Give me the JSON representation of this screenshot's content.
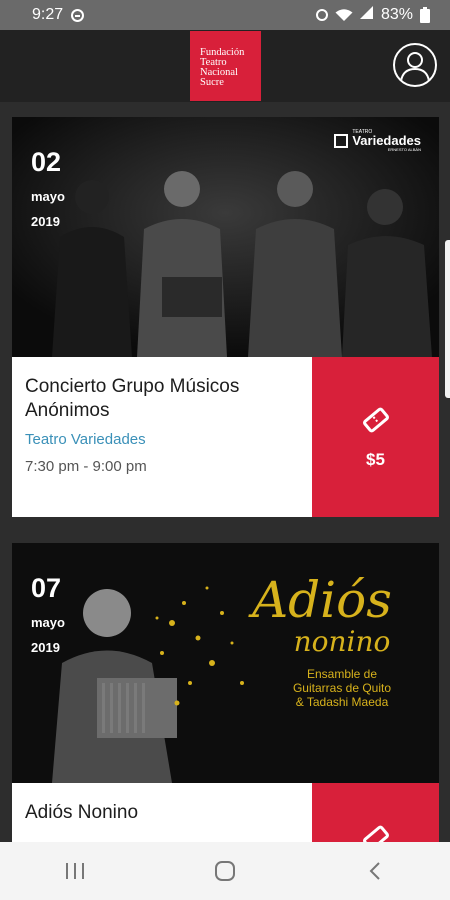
{
  "status_bar": {
    "time": "9:27",
    "battery": "83%"
  },
  "header": {
    "logo_lines": [
      "Fundación",
      "Teatro",
      "Nacional",
      "Sucre"
    ],
    "brand_color": "#d8203a"
  },
  "events": [
    {
      "day": "02",
      "month": "mayo",
      "year": "2019",
      "title": "Concierto Grupo Músicos Anónimos",
      "venue": "Teatro Variedades",
      "time": "7:30 pm - 9:00 pm",
      "price": "$5",
      "poster": {
        "badge_small": "TEATRO",
        "badge_name": "Variedades",
        "badge_sub": "ERNESTO ALBÁN"
      }
    },
    {
      "day": "07",
      "month": "mayo",
      "year": "2019",
      "title": "Adiós Nonino",
      "poster": {
        "headline": "Adiós",
        "subheadline": "nonino",
        "lines": [
          "Ensamble de",
          "Guitarras de Quito",
          "& Tadashi Maeda"
        ]
      }
    }
  ],
  "icons": {
    "ticket": "ticket-icon",
    "profile": "profile-icon",
    "nav_recent": "recent-apps-icon",
    "nav_home": "home-icon",
    "nav_back": "back-icon"
  }
}
